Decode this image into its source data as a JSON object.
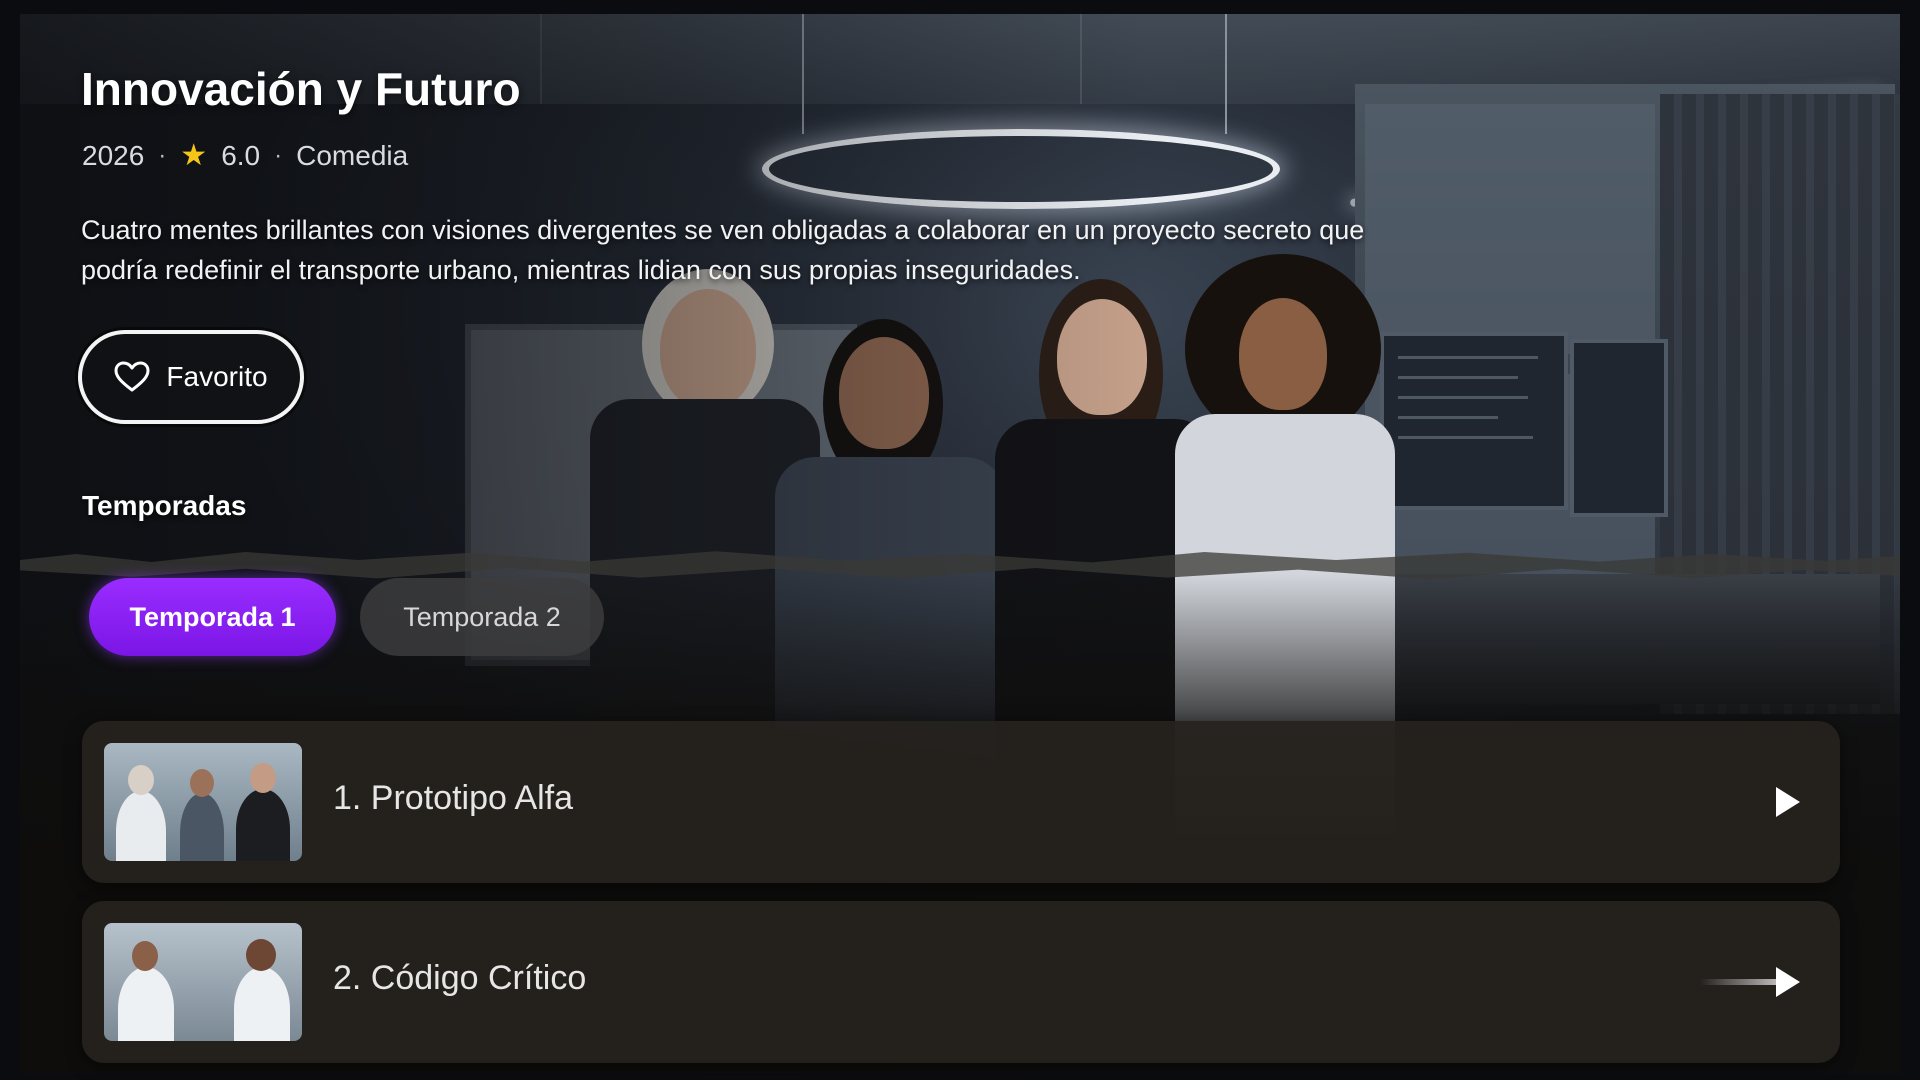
{
  "show": {
    "title": "Innovación y Futuro",
    "year": "2026",
    "rating": "6.0",
    "genre": "Comedia",
    "separator": "·",
    "description": "Cuatro mentes brillantes con visiones divergentes se ven obligadas a colaborar en un proyecto secreto que podría redefinir el transporte urbano, mientras lidian con sus propias inseguridades."
  },
  "actions": {
    "favorite_label": "Favorito",
    "favorite_icon": "heart-outline-icon"
  },
  "seasons": {
    "heading": "Temporadas",
    "tabs": [
      {
        "label": "Temporada 1",
        "selected": true
      },
      {
        "label": "Temporada 2",
        "selected": false
      }
    ]
  },
  "episodes": [
    {
      "title": "1. Prototipo Alfa",
      "icon": "play-icon"
    },
    {
      "title": "2. Código Crítico",
      "icon": "play-icon"
    }
  ],
  "colors": {
    "accent": "#8a22f5",
    "rating_star": "#f5c518",
    "card_bg": "#26231e"
  }
}
